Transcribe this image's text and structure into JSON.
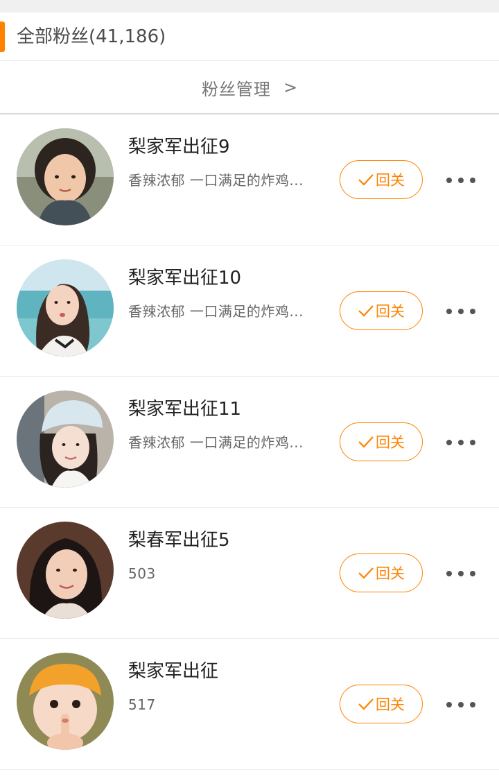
{
  "header": {
    "title": "全部粉丝(41,186)"
  },
  "manage": {
    "label": "粉丝管理",
    "chevron": ">"
  },
  "colors": {
    "accent": "#ff8200",
    "divider": "#ececec"
  },
  "fans": [
    {
      "name": "梨家军出征9",
      "desc": "香辣浓郁 一口满足的炸鸡...",
      "follow_label": "回关",
      "avatar_icon": "user-avatar-photo"
    },
    {
      "name": "梨家军出征10",
      "desc": "香辣浓郁 一口满足的炸鸡...",
      "follow_label": "回关",
      "avatar_icon": "user-avatar-photo"
    },
    {
      "name": "梨家军出征11",
      "desc": "香辣浓郁 一口满足的炸鸡...",
      "follow_label": "回关",
      "avatar_icon": "user-avatar-photo"
    },
    {
      "name": "梨春军出征5",
      "desc": "503",
      "follow_label": "回关",
      "avatar_icon": "user-avatar-photo"
    },
    {
      "name": "梨家军出征",
      "desc": "517",
      "follow_label": "回关",
      "avatar_icon": "user-avatar-photo"
    }
  ]
}
